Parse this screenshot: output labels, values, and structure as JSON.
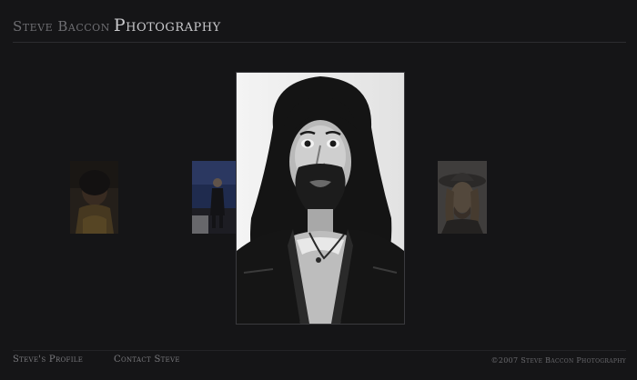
{
  "header": {
    "name": "Steve Baccon",
    "brand": "Photography"
  },
  "gallery": {
    "thumbnails": [
      {
        "icon": "portrait-thumbnail-1"
      },
      {
        "icon": "portrait-thumbnail-2"
      },
      {
        "icon": "portrait-thumbnail-3"
      }
    ],
    "featured": {
      "icon": "featured-portrait"
    }
  },
  "footer": {
    "profile_link": "Steve's Profile",
    "contact_link": "Contact Steve",
    "copyright": "©2007 Steve Baccon Photography"
  }
}
